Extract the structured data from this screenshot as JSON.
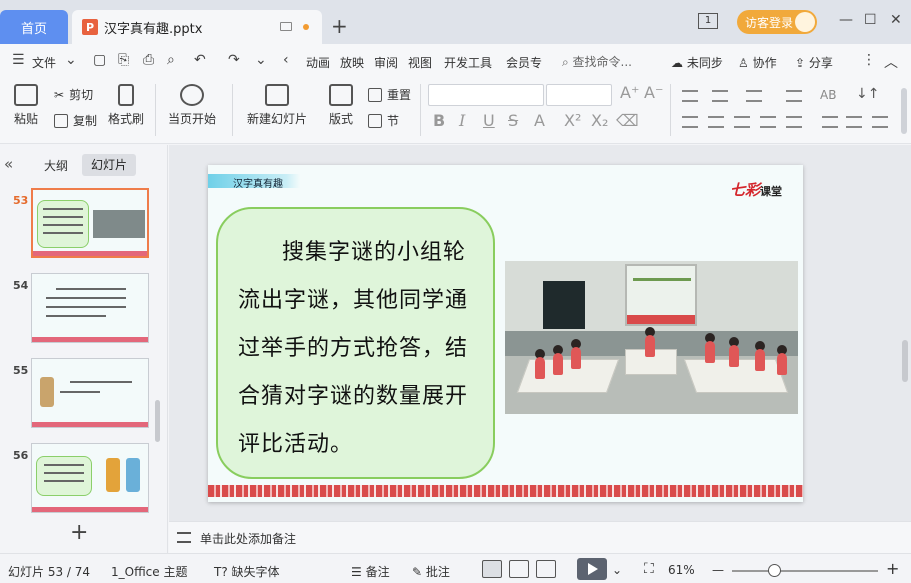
{
  "titlebar": {
    "home_tab": "首页",
    "doc_tab": "汉字真有趣.pptx",
    "doc_badge": "P",
    "new_tab": "+",
    "page_indicator": "1",
    "visitor_login": "访客登录",
    "minimize": "—",
    "maximize": "☐",
    "close": "✕"
  },
  "menubar": {
    "file": "文件",
    "items": [
      "动画",
      "放映",
      "审阅",
      "视图",
      "开发工具",
      "会员专"
    ],
    "search": "查找命令...",
    "sync": "未同步",
    "collab": "协作",
    "share": "分享"
  },
  "ribbon": {
    "paste": "粘贴",
    "cut": "剪切",
    "copy": "复制",
    "format_painter": "格式刷",
    "start_from_current": "当页开始",
    "new_slide": "新建幻灯片",
    "layout": "版式",
    "reset": "重置",
    "section": "节",
    "bold": "B",
    "italic": "I",
    "underline": "U",
    "strike": "S",
    "font_color": "A",
    "superscript": "X²",
    "subscript": "X₂",
    "grow_font": "A⁺",
    "shrink_font": "A⁻",
    "ab_label": "AB"
  },
  "leftpanel": {
    "tab_outline": "大纲",
    "tab_slides": "幻灯片",
    "slides": [
      {
        "num": "53",
        "active": true
      },
      {
        "num": "54",
        "active": false
      },
      {
        "num": "55",
        "active": false
      },
      {
        "num": "56",
        "active": false
      }
    ],
    "add_slide": "+"
  },
  "slide": {
    "title": "汉字真有趣",
    "logo_main": "七彩",
    "logo_sub": "课堂",
    "body": "搜集字谜的小组轮流出字谜，其他同学通过举手的方式抢答，结合猜对字谜的数量展开评比活动。"
  },
  "notes": {
    "placeholder": "单击此处添加备注"
  },
  "statusbar": {
    "slide_count": "幻灯片 53 / 74",
    "theme": "1_Office 主题",
    "missing_font": "缺失字体",
    "notes": "备注",
    "comments": "批注",
    "zoom": "61%",
    "zoom_out": "—",
    "zoom_in": "+"
  }
}
